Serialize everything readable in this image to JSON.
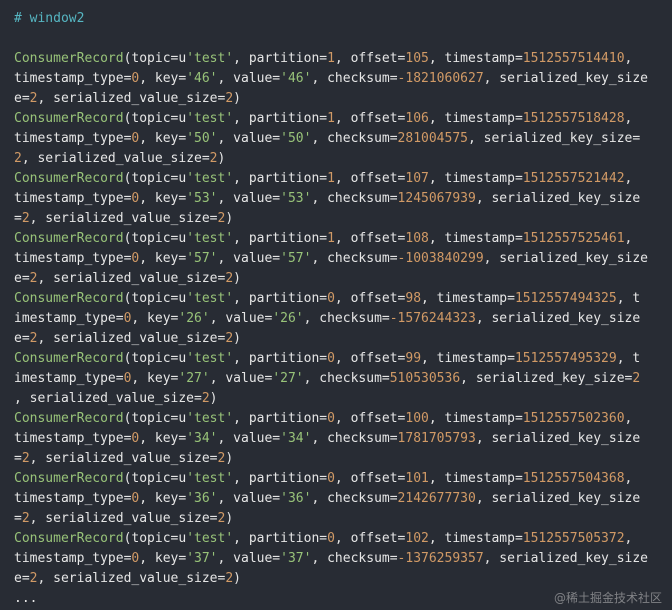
{
  "comment": "# window2",
  "lines": [
    "",
    "ConsumerRecord(topic=u'test', partition=1, offset=105, timestamp=1512557514410,",
    "timestamp_type=0, key='46', value='46', checksum=-1821060627, serialized_key_size",
    "e=2, serialized_value_size=2)",
    "ConsumerRecord(topic=u'test', partition=1, offset=106, timestamp=1512557518428,",
    "timestamp_type=0, key='50', value='50', checksum=281004575, serialized_key_size=",
    "2, serialized_value_size=2)",
    "ConsumerRecord(topic=u'test', partition=1, offset=107, timestamp=1512557521442,",
    "timestamp_type=0, key='53', value='53', checksum=1245067939, serialized_key_size",
    "=2, serialized_value_size=2)",
    "ConsumerRecord(topic=u'test', partition=1, offset=108, timestamp=1512557525461,",
    "timestamp_type=0, key='57', value='57', checksum=-1003840299, serialized_key_size",
    "e=2, serialized_value_size=2)",
    "ConsumerRecord(topic=u'test', partition=0, offset=98, timestamp=1512557494325, t",
    "imestamp_type=0, key='26', value='26', checksum=-1576244323, serialized_key_size",
    "e=2, serialized_value_size=2)",
    "ConsumerRecord(topic=u'test', partition=0, offset=99, timestamp=1512557495329, t",
    "imestamp_type=0, key='27', value='27', checksum=510530536, serialized_key_size=2",
    ", serialized_value_size=2)",
    "ConsumerRecord(topic=u'test', partition=0, offset=100, timestamp=1512557502360,",
    "timestamp_type=0, key='34', value='34', checksum=1781705793, serialized_key_size",
    "=2, serialized_value_size=2)",
    "ConsumerRecord(topic=u'test', partition=0, offset=101, timestamp=1512557504368,",
    "timestamp_type=0, key='36', value='36', checksum=2142677730, serialized_key_size",
    "=2, serialized_value_size=2)",
    "ConsumerRecord(topic=u'test', partition=0, offset=102, timestamp=1512557505372,",
    "timestamp_type=0, key='37', value='37', checksum=-1376259357, serialized_key_size",
    "e=2, serialized_value_size=2)",
    "..."
  ],
  "watermark": "@稀土掘金技术社区",
  "colors": {
    "background": "#282c34",
    "comment": "#56b6c2",
    "text": "#e6e6e6",
    "class_name": "#98c379",
    "number": "#d19a66",
    "string": "#98c379"
  }
}
